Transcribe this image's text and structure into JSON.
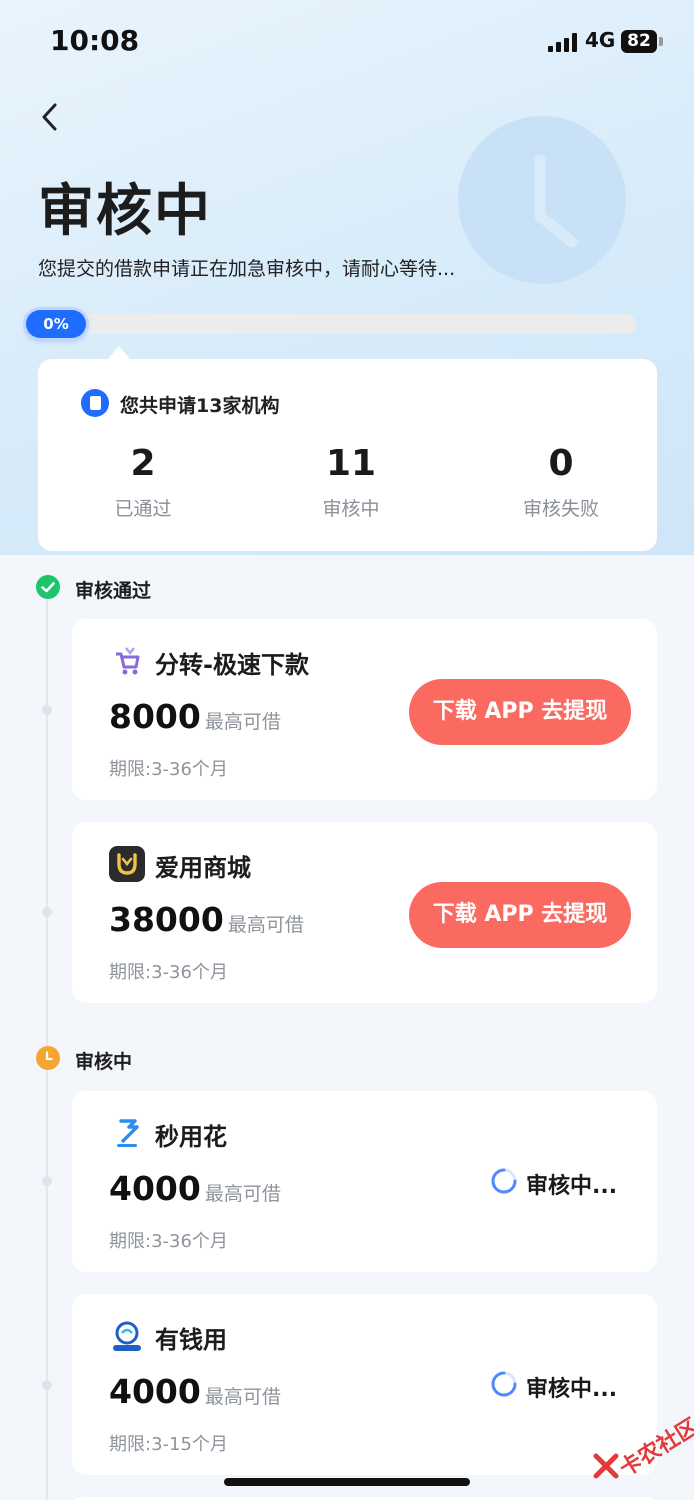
{
  "status_bar": {
    "time": "10:08",
    "network": "4G",
    "battery": "82"
  },
  "header": {
    "title": "审核中",
    "subtitle": "您提交的借款申请正在加急审核中，请耐心等待..."
  },
  "progress": {
    "label": "0%",
    "value": 0
  },
  "summary": {
    "text": "您共申请13家机构",
    "stats": [
      {
        "value": "2",
        "label": "已通过"
      },
      {
        "value": "11",
        "label": "审核中"
      },
      {
        "value": "0",
        "label": "审核失败"
      }
    ]
  },
  "sections": {
    "approved": {
      "title": "审核通过",
      "cards": [
        {
          "name": "分转-极速下款",
          "amount": "8000",
          "amount_label": "最高可借",
          "term": "期限:3-36个月",
          "button": "下载 APP 去提现"
        },
        {
          "name": "爱用商城",
          "amount": "38000",
          "amount_label": "最高可借",
          "term": "期限:3-36个月",
          "button": "下载 APP 去提现"
        }
      ]
    },
    "reviewing": {
      "title": "审核中",
      "cards": [
        {
          "name": "秒用花",
          "amount": "4000",
          "amount_label": "最高可借",
          "term": "期限:3-36个月",
          "status": "审核中..."
        },
        {
          "name": "有钱用",
          "amount": "4000",
          "amount_label": "最高可借",
          "term": "期限:3-15个月",
          "status": "审核中..."
        }
      ]
    }
  },
  "watermark": "卡农社区",
  "colors": {
    "accent_blue": "#1f6dff",
    "button_red": "#fb6a60",
    "success_green": "#1ec46b",
    "pending_orange": "#f7a531"
  },
  "icons": [
    "back-chevron-icon",
    "clock-icon",
    "document-icon",
    "check-icon",
    "clock-icon",
    "spinner-icon"
  ]
}
